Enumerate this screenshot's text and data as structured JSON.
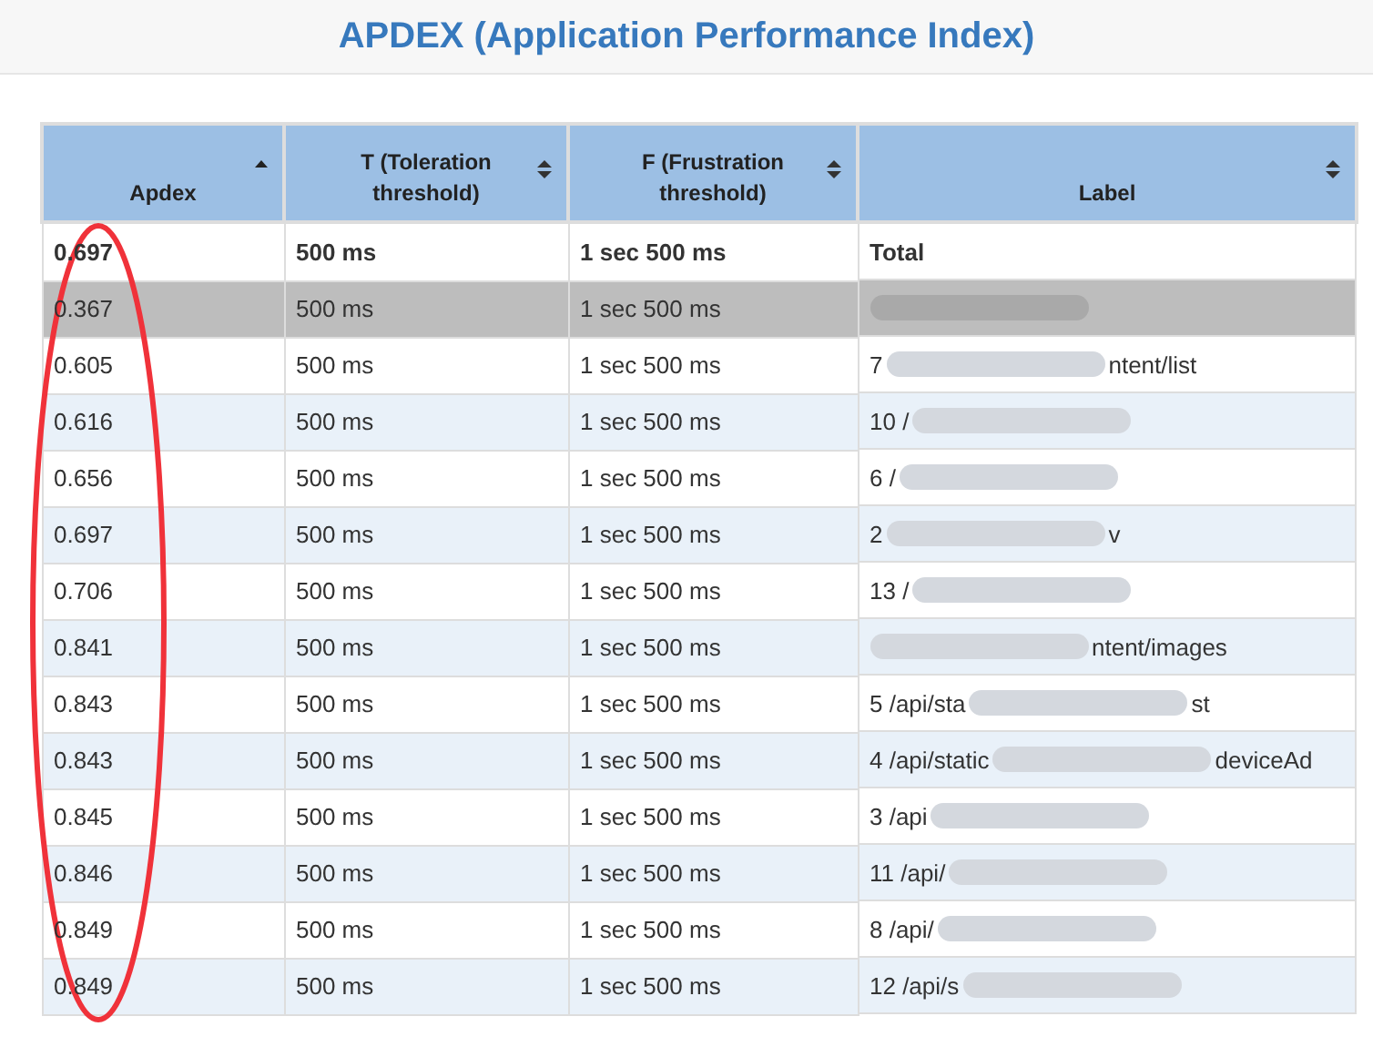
{
  "title": "APDEX (Application Performance Index)",
  "table": {
    "columns": [
      {
        "label": "Apdex",
        "sorted": true
      },
      {
        "label": "T (Toleration threshold)",
        "sorted": false
      },
      {
        "label": "F (Frustration threshold)",
        "sorted": false
      },
      {
        "label": "Label",
        "sorted": false
      }
    ],
    "rows": [
      {
        "kind": "total",
        "highlighted": false,
        "apdex": "0.697",
        "t": "500 ms",
        "f": "1 sec 500 ms",
        "label": "Total"
      },
      {
        "kind": "item",
        "highlighted": true,
        "apdex": "0.367",
        "t": "500 ms",
        "f": "1 sec 500 ms"
      },
      {
        "kind": "item",
        "highlighted": false,
        "apdex": "0.605",
        "t": "500 ms",
        "f": "1 sec 500 ms",
        "label": "7",
        "label_end": "ntent/list"
      },
      {
        "kind": "item",
        "highlighted": false,
        "apdex": "0.616",
        "t": "500 ms",
        "f": "1 sec 500 ms",
        "label": "10 /"
      },
      {
        "kind": "item",
        "highlighted": false,
        "apdex": "0.656",
        "t": "500 ms",
        "f": "1 sec 500 ms",
        "label": "6 /"
      },
      {
        "kind": "item",
        "highlighted": false,
        "apdex": "0.697",
        "t": "500 ms",
        "f": "1 sec 500 ms",
        "label": "2",
        "label_end": "v"
      },
      {
        "kind": "item",
        "highlighted": false,
        "apdex": "0.706",
        "t": "500 ms",
        "f": "1 sec 500 ms",
        "label": "13 /"
      },
      {
        "kind": "item",
        "highlighted": false,
        "apdex": "0.841",
        "t": "500 ms",
        "f": "1 sec 500 ms",
        "label_end": "ntent/images"
      },
      {
        "kind": "item",
        "highlighted": false,
        "apdex": "0.843",
        "t": "500 ms",
        "f": "1 sec 500 ms",
        "label": "5 /api/sta",
        "label_end": "st"
      },
      {
        "kind": "item",
        "highlighted": false,
        "apdex": "0.843",
        "t": "500 ms",
        "f": "1 sec 500 ms",
        "label": "4 /api/static",
        "label_end": "deviceAd"
      },
      {
        "kind": "item",
        "highlighted": false,
        "apdex": "0.845",
        "t": "500 ms",
        "f": "1 sec 500 ms",
        "label": "3 /api"
      },
      {
        "kind": "item",
        "highlighted": false,
        "apdex": "0.846",
        "t": "500 ms",
        "f": "1 sec 500 ms",
        "label": "11 /api/"
      },
      {
        "kind": "item",
        "highlighted": false,
        "apdex": "0.849",
        "t": "500 ms",
        "f": "1 sec 500 ms",
        "label": "8 /api/"
      },
      {
        "kind": "item",
        "highlighted": false,
        "apdex": "0.849",
        "t": "500 ms",
        "f": "1 sec 500 ms",
        "label": "12 /api/s"
      }
    ]
  },
  "annotation": {
    "kind": "ellipse"
  }
}
